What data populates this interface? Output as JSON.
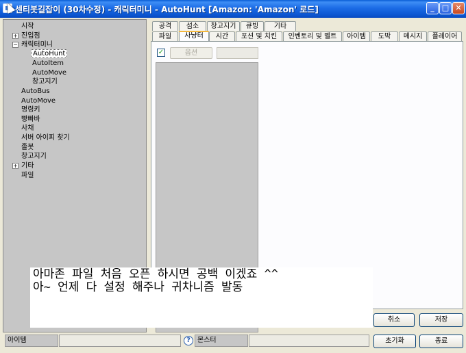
{
  "window": {
    "title": "센티봇길잡이 (30차수정) - 캐릭터미니 - AutoHunt [Amazon: 'Amazon' 로드]",
    "controls": {
      "minimize": "_",
      "maximize": "□",
      "close": "✕"
    }
  },
  "tree": {
    "items": [
      {
        "label": "시작",
        "expander": ""
      },
      {
        "label": "진입점",
        "expander": "+"
      },
      {
        "label": "캐릭터미니",
        "expander": "−"
      },
      {
        "label": "AutoHunt",
        "expander": ""
      },
      {
        "label": "AutoItem",
        "expander": ""
      },
      {
        "label": "AutoMove",
        "expander": ""
      },
      {
        "label": "창고지기",
        "expander": ""
      },
      {
        "label": "AutoBus",
        "expander": ""
      },
      {
        "label": "AutoMove",
        "expander": ""
      },
      {
        "label": "명령키",
        "expander": ""
      },
      {
        "label": "빵빠바",
        "expander": ""
      },
      {
        "label": "사채",
        "expander": ""
      },
      {
        "label": "서버 아이피 찾기",
        "expander": ""
      },
      {
        "label": "졸봇",
        "expander": ""
      },
      {
        "label": "창고지기",
        "expander": ""
      },
      {
        "label": "기타",
        "expander": "+"
      },
      {
        "label": "파일",
        "expander": ""
      }
    ]
  },
  "tabs_row1": [
    {
      "label": "공격"
    },
    {
      "label": "섬소"
    },
    {
      "label": "창고지기"
    },
    {
      "label": "큐빙"
    },
    {
      "label": "기타"
    }
  ],
  "tabs_row2": [
    {
      "label": "파일"
    },
    {
      "label": "사냥터"
    },
    {
      "label": "시간"
    },
    {
      "label": "포션 및 치킨"
    },
    {
      "label": "인벤토리 및 벨트"
    },
    {
      "label": "아이템"
    },
    {
      "label": "도박"
    },
    {
      "label": "메시지"
    },
    {
      "label": "플레이어"
    }
  ],
  "panel": {
    "checkbox_mark": "✓",
    "option_button": "옵션"
  },
  "buttons": {
    "cancel": "취소",
    "save": "저장",
    "reset": "초기화",
    "exit": "종료"
  },
  "status": {
    "left_label": "아이템",
    "help": "?",
    "right_label": "몬스터"
  },
  "overlay": {
    "line1": "아마존 파일 처음 오픈 하시면 공백 이겠죠 ^^",
    "line2": "아~ 언제 다 설정 해주나 귀차니즘 발동"
  }
}
